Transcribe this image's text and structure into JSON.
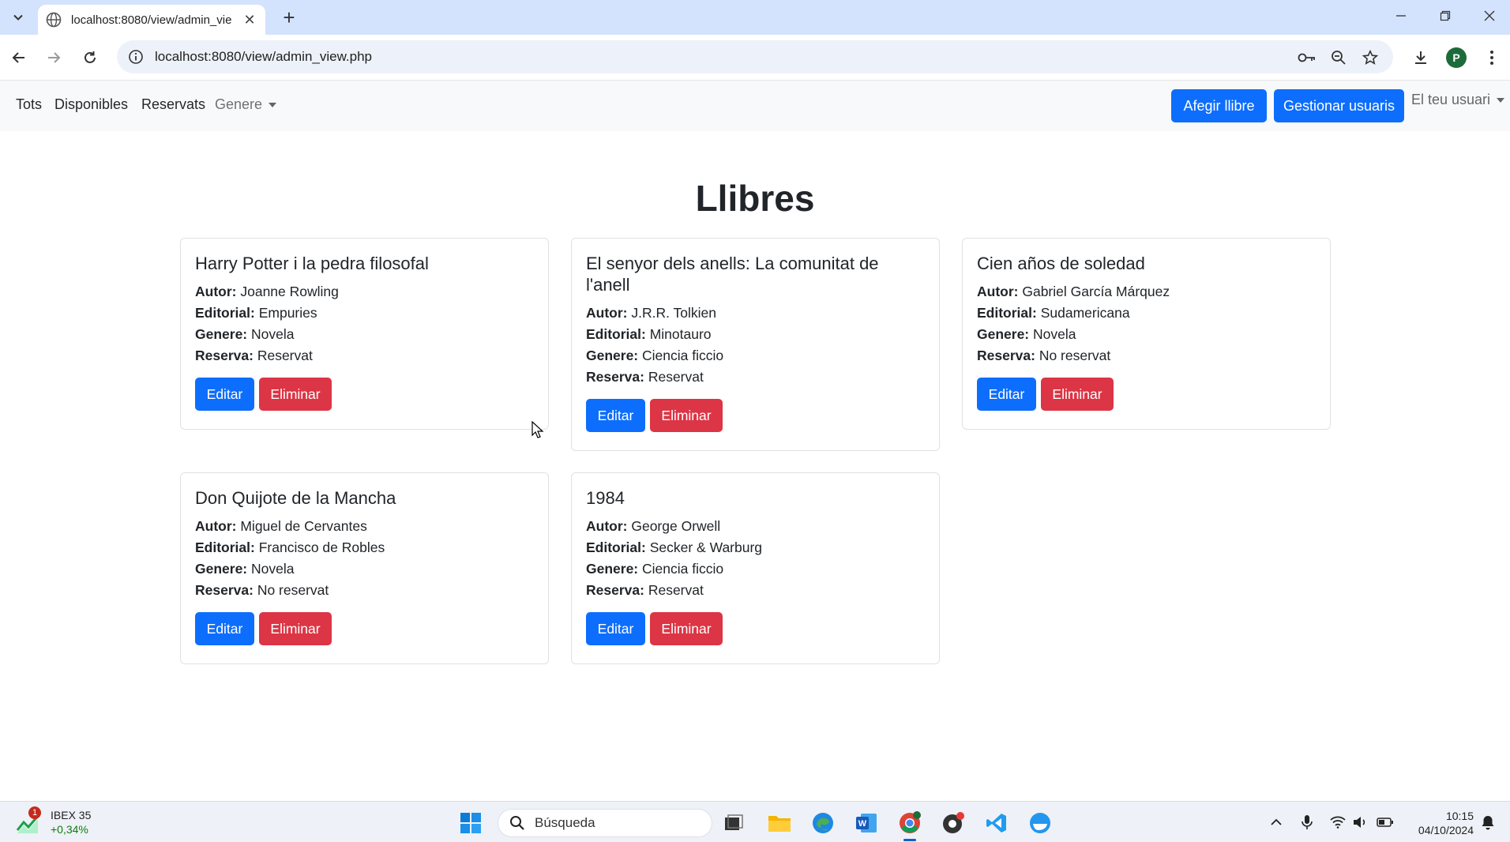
{
  "browser": {
    "tab_title": "localhost:8080/view/admin_vie",
    "url": "localhost:8080/view/admin_view.php",
    "profile_initial": "P"
  },
  "navbar": {
    "links": [
      "Tots",
      "Disponibles",
      "Reservats"
    ],
    "genre_dropdown": "Genere",
    "add_book": "Afegir llibre",
    "manage_users": "Gestionar usuaris",
    "user_menu": "El teu usuari"
  },
  "page": {
    "title": "Llibres"
  },
  "labels": {
    "author": "Autor:",
    "publisher": "Editorial:",
    "genre": "Genere:",
    "reservation": "Reserva:",
    "edit": "Editar",
    "delete": "Eliminar"
  },
  "books": [
    {
      "title": "Harry Potter i la pedra filosofal",
      "author": "Joanne Rowling",
      "publisher": "Empuries",
      "genre": "Novela",
      "reservation": "Reservat"
    },
    {
      "title": "El senyor dels anells: La comunitat de l'anell",
      "author": "J.R.R. Tolkien",
      "publisher": "Minotauro",
      "genre": "Ciencia ficcio",
      "reservation": "Reservat"
    },
    {
      "title": "Cien años de soledad",
      "author": "Gabriel García Márquez",
      "publisher": "Sudamericana",
      "genre": "Novela",
      "reservation": "No reservat"
    },
    {
      "title": "Don Quijote de la Mancha",
      "author": "Miguel de Cervantes",
      "publisher": "Francisco de Robles",
      "genre": "Novela",
      "reservation": "No reservat"
    },
    {
      "title": "1984",
      "author": "George Orwell",
      "publisher": "Secker & Warburg",
      "genre": "Ciencia ficcio",
      "reservation": "Reservat"
    }
  ],
  "taskbar": {
    "widget_name": "IBEX 35",
    "widget_value": "+0,34%",
    "widget_badge": "1",
    "search_placeholder": "Búsqueda",
    "time": "10:15",
    "date": "04/10/2024"
  },
  "colors": {
    "primary": "#0d6efd",
    "danger": "#dc3545",
    "navbar_bg": "#f8f9fa"
  }
}
